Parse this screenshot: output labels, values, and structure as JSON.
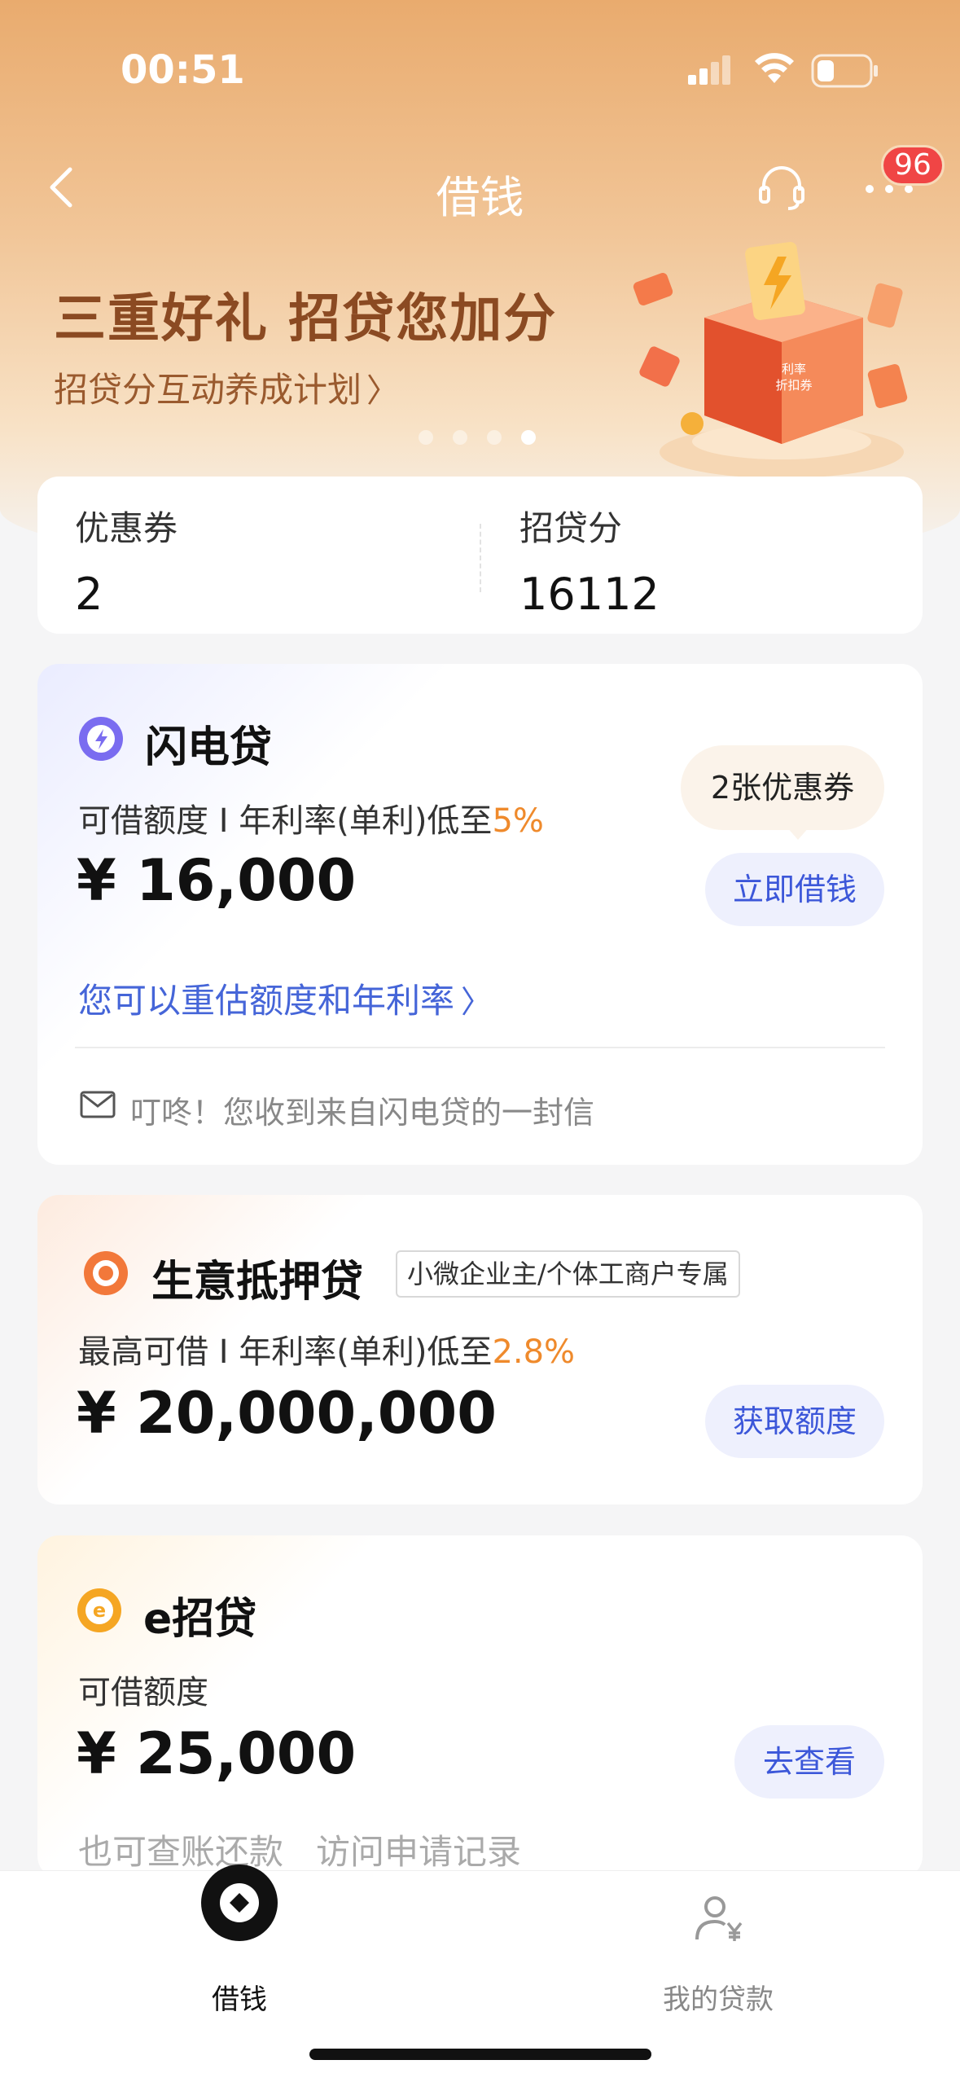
{
  "status": {
    "time": "00:51"
  },
  "nav": {
    "title": "借钱",
    "badge_count": "96"
  },
  "banner": {
    "title": "三重好礼 招贷您加分",
    "subtitle": "招贷分互动养成计划",
    "chevron": "〉",
    "page_count": 4,
    "active_page": 4,
    "art_label_line1": "利率",
    "art_label_line2": "折扣券"
  },
  "summary": {
    "coupons_label": "优惠券",
    "coupons_value": "2",
    "score_label": "招贷分",
    "score_value": "16112"
  },
  "flash_loan": {
    "name": "闪电贷",
    "desc_prefix": "可借额度 I 年利率(单利)低至",
    "rate": "5%",
    "amount": "¥ 16,000",
    "coupon_bubble": "2张优惠券",
    "action": "立即借钱",
    "reassess_link": "您可以重估额度和年利率",
    "link_chevron": "〉",
    "letter_text": "叮咚！您收到来自闪电贷的一封信"
  },
  "business_loan": {
    "name": "生意抵押贷",
    "tag": "小微企业主/个体工商户专属",
    "desc_prefix": "最高可借 I 年利率(单利)低至",
    "rate": "2.8%",
    "amount": "¥ 20,000,000",
    "action": "获取额度"
  },
  "e_loan": {
    "name": "e招贷",
    "desc": "可借额度",
    "amount": "¥ 25,000",
    "action": "去查看",
    "link_1": "也可查账还款",
    "link_2": "访问申请记录"
  },
  "tabbar": {
    "borrow_label": "借钱",
    "loans_label": "我的贷款"
  },
  "colors": {
    "accent_blue": "#3c57d9",
    "rate_orange": "#ef8a2c",
    "badge_red": "#f04545"
  }
}
